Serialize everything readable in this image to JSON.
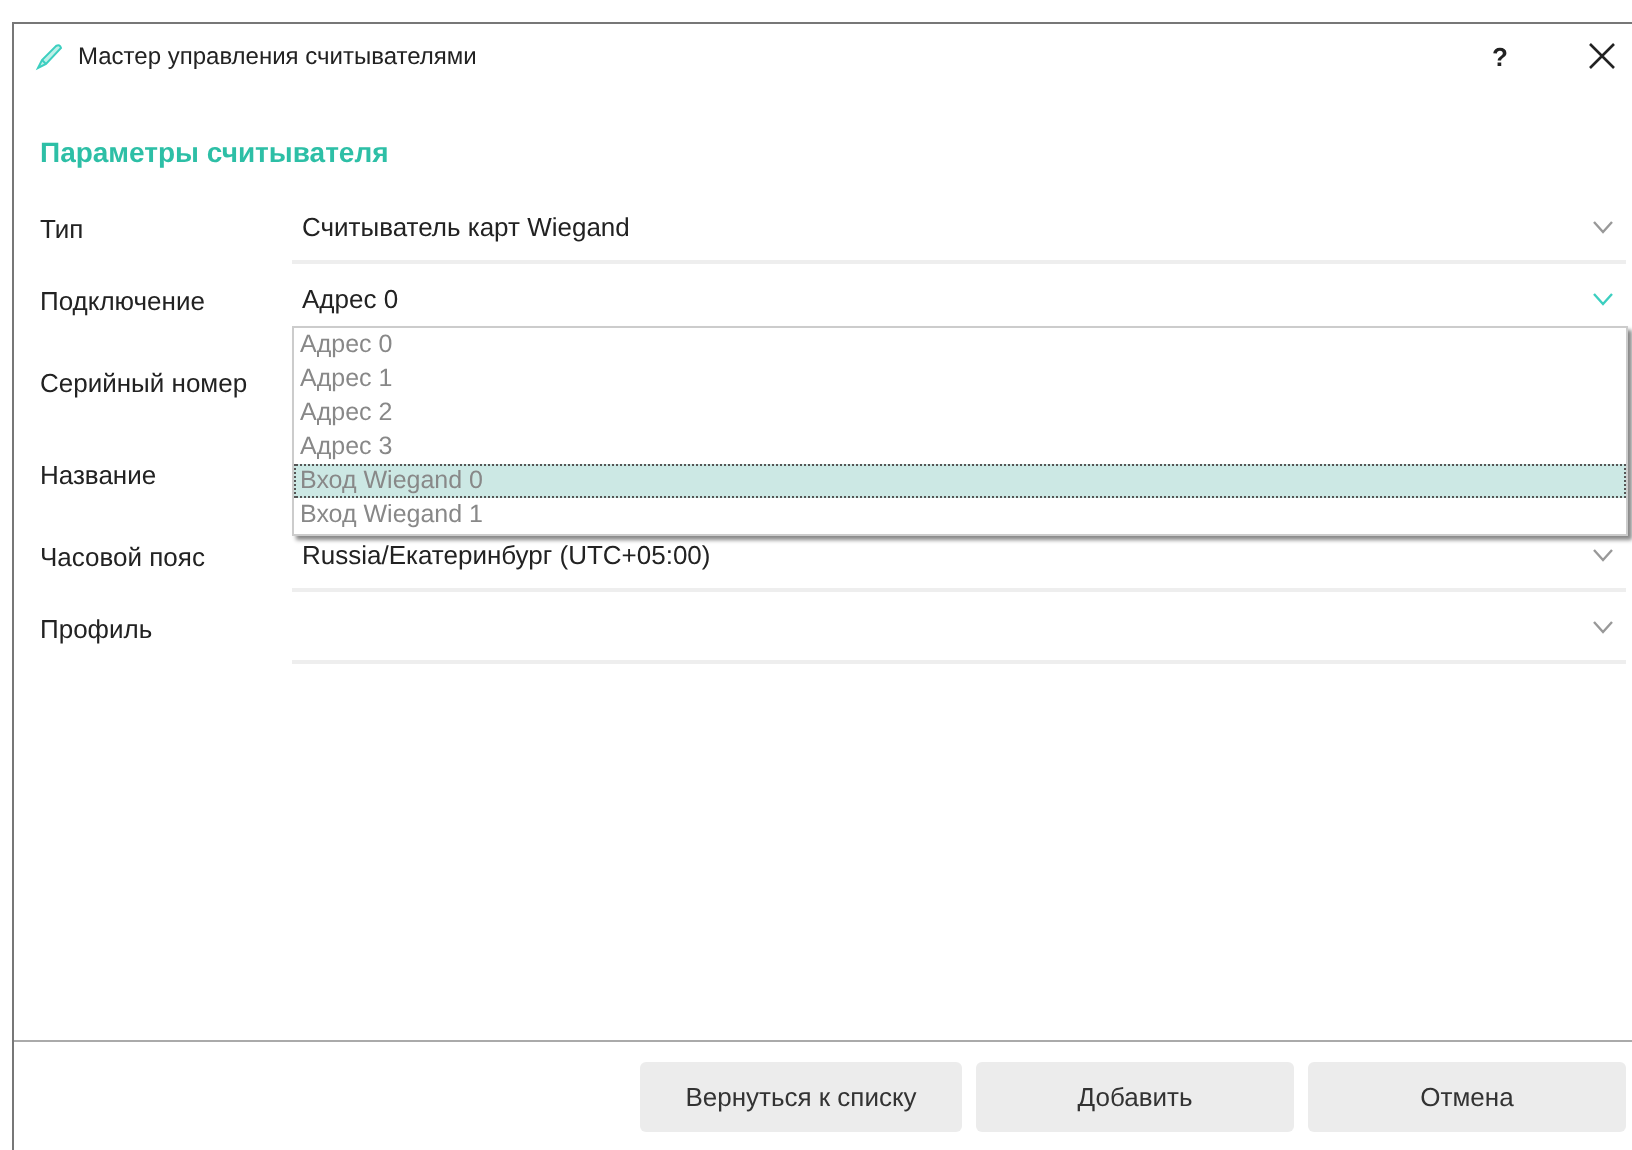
{
  "window": {
    "title": "Мастер управления считывателями",
    "help": "?"
  },
  "section_title": "Параметры считывателя",
  "fields": [
    {
      "label": "Тип",
      "kind": "select",
      "value": "Считыватель карт Wiegand",
      "focused": false
    },
    {
      "label": "Подключение",
      "kind": "select",
      "value": "Адрес 0",
      "focused": true,
      "expanded": true,
      "options": [
        {
          "label": "Адрес 0",
          "highlighted": false
        },
        {
          "label": "Адрес 1",
          "highlighted": false
        },
        {
          "label": "Адрес 2",
          "highlighted": false
        },
        {
          "label": "Адрес 3",
          "highlighted": false
        },
        {
          "label": "Вход Wiegand 0",
          "highlighted": true
        },
        {
          "label": "Вход Wiegand 1",
          "highlighted": false
        }
      ]
    },
    {
      "label": "Серийный номер",
      "kind": "input"
    },
    {
      "label": "Название",
      "kind": "input"
    },
    {
      "label": "Часовой пояс",
      "kind": "select",
      "value": "Russia/Екатеринбург (UTC+05:00)",
      "focused": false
    },
    {
      "label": "Профиль",
      "kind": "select",
      "focused": false
    }
  ],
  "buttons": [
    "Вернуться к списку",
    "Добавить",
    "Отмена"
  ]
}
